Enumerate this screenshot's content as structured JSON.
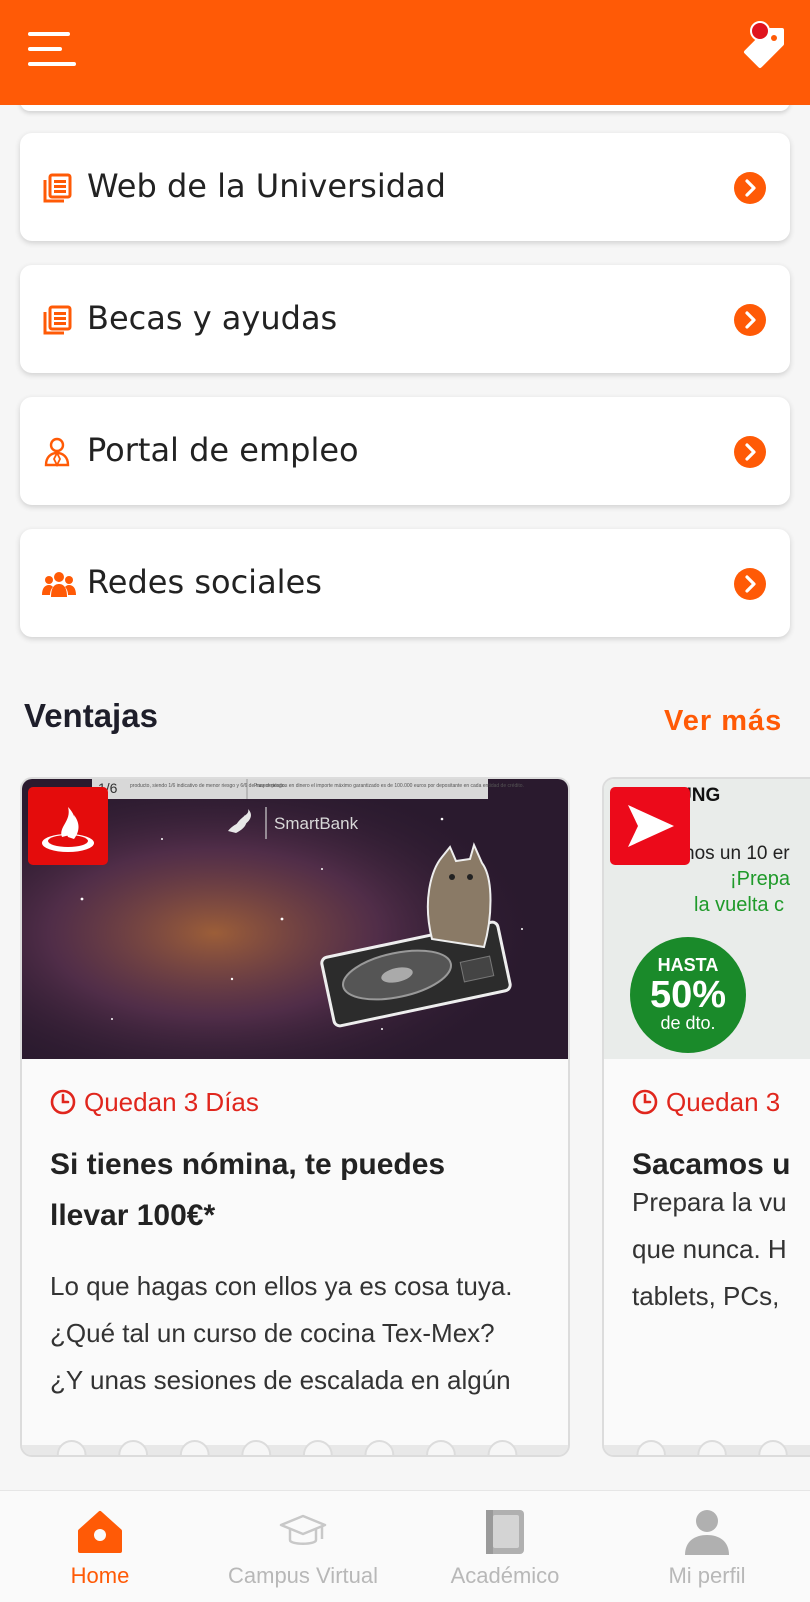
{
  "header": {
    "menu_icon": "hamburger-icon",
    "offers_icon": "tag-icon",
    "accent": "#ff5a06",
    "badge_color": "#e0141e"
  },
  "links": [
    {
      "label": "Web de la Universidad",
      "icon": "document-list-icon"
    },
    {
      "label": "Becas y ayudas",
      "icon": "document-list-icon"
    },
    {
      "label": "Portal de empleo",
      "icon": "person-icon"
    },
    {
      "label": "Redes sociales",
      "icon": "group-icon"
    }
  ],
  "ventajas": {
    "title": "Ventajas",
    "see_more": "Ver más",
    "cards": [
      {
        "time_left": "Quedan 3 Días",
        "title": "Si tienes nómina, te puedes\nllevar 100€*",
        "description": "Lo que hagas con ellos ya es cosa tuya.\n¿Qué tal un curso de cocina Tex-Mex?\n¿Y unas sesiones de escalada en algún\nsitio tropical? O quizás prefieres un ki",
        "brand": "santander-logo",
        "image": {
          "top_text_1": "1/6",
          "top_text_2": "producto, siendo 1/6 indicativo de menor riesgo y 6/6 de mayor riesgo.",
          "top_text_3": "Para depósitos en dinero el importe máximo garantizado es de 100.000 euros por depositante en cada entidad de crédito.",
          "logo_text": "SmartBank"
        }
      },
      {
        "time_left": "Quedan 3",
        "title": "Sacamos u",
        "description": "Prepara la vu\nque nunca. H\ntablets, PCs,\nSolo desde e",
        "brand": "play-arrow-logo",
        "image": {
          "brand_text": "UNG",
          "line_1": "nos un 10 er",
          "line_2": "¡Prepa",
          "line_3": "la vuelta c",
          "badge_top": "HASTA",
          "badge_value": "50%",
          "badge_bottom": "de dto."
        }
      }
    ]
  },
  "bottom_nav": [
    {
      "label": "Home",
      "icon": "home-icon",
      "active": true
    },
    {
      "label": "Campus Virtual",
      "icon": "graduation-cap-icon",
      "active": false
    },
    {
      "label": "Académico",
      "icon": "book-icon",
      "active": false
    },
    {
      "label": "Mi perfil",
      "icon": "user-icon",
      "active": false
    }
  ]
}
